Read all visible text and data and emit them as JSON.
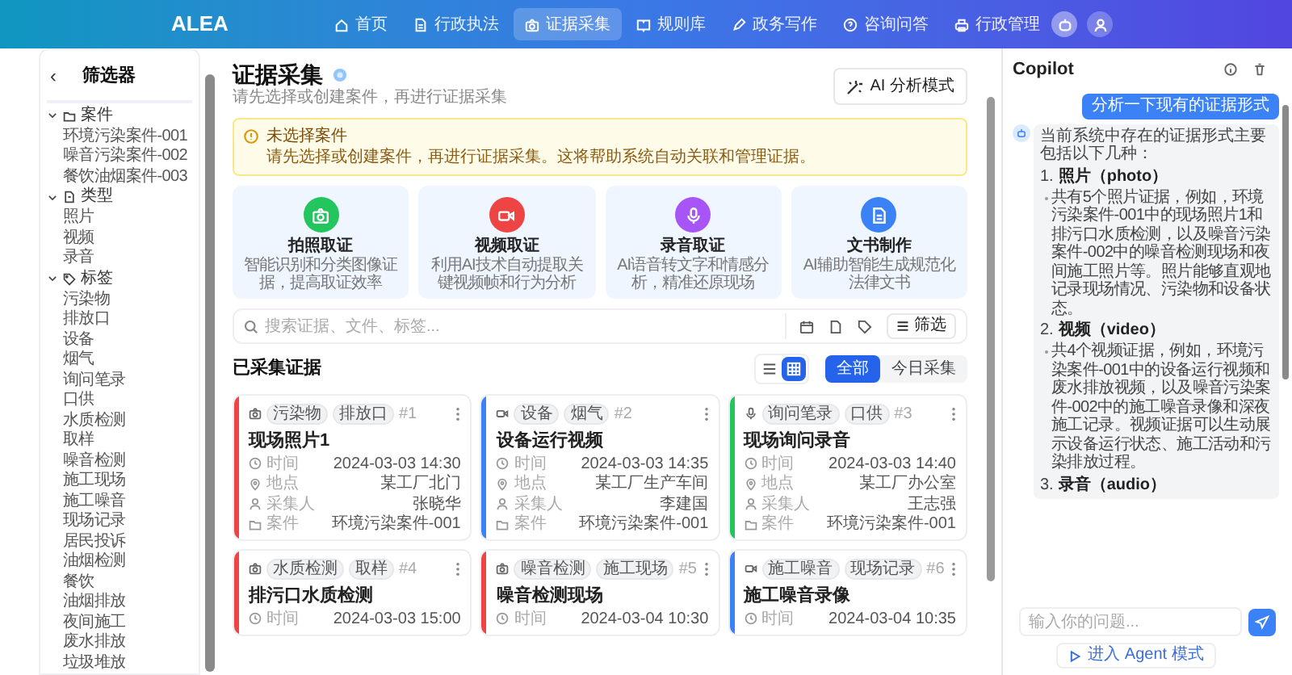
{
  "nav": {
    "logo": "ALEA",
    "items": [
      {
        "label": "首页",
        "selected": false
      },
      {
        "label": "行政执法",
        "selected": false
      },
      {
        "label": "证据采集",
        "selected": true
      },
      {
        "label": "规则库",
        "selected": false
      },
      {
        "label": "政务写作",
        "selected": false
      },
      {
        "label": "咨询问答",
        "selected": false
      },
      {
        "label": "行政管理",
        "selected": false
      }
    ]
  },
  "sidebar": {
    "back": "‹",
    "title": "筛选器",
    "groups": [
      {
        "label": "案件",
        "expanded": true,
        "children": [
          "环境污染案件-001",
          "噪音污染案件-002",
          "餐饮油烟案件-003"
        ]
      },
      {
        "label": "类型",
        "expanded": true,
        "children": [
          "照片",
          "视频",
          "录音"
        ]
      },
      {
        "label": "标签",
        "expanded": true,
        "children": [
          "污染物",
          "排放口",
          "设备",
          "烟气",
          "询问笔录",
          "口供",
          "水质检测",
          "取样",
          "噪音检测",
          "施工现场",
          "施工噪音",
          "现场记录",
          "居民投诉",
          "油烟检测",
          "餐饮",
          "油烟排放",
          "夜间施工",
          "废水排放",
          "垃圾堆放"
        ]
      }
    ]
  },
  "main": {
    "title": "证据采集",
    "subtitle": "请先选择或创建案件，再进行证据采集",
    "ai_button": "AI 分析模式",
    "alert": {
      "title": "未选择案件",
      "text": "请先选择或创建案件，再进行证据采集。这将帮助系统自动关联和管理证据。"
    },
    "features": [
      {
        "kind": "photo",
        "color": "#22c55e",
        "title": "拍照取证",
        "text": "智能识别和分类图像证据，提高取证效率"
      },
      {
        "kind": "video",
        "color": "#ef4444",
        "title": "视频取证",
        "text": "利用AI技术自动提取关键视频帧和行为分析"
      },
      {
        "kind": "audio",
        "color": "#a855f7",
        "title": "录音取证",
        "text": "AI语音转文字和情感分析，精准还原现场"
      },
      {
        "kind": "doc",
        "color": "#3b82f6",
        "title": "文书制作",
        "text": "AI辅助智能生成规范化法律文书"
      }
    ],
    "search": {
      "placeholder": "搜索证据、文件、标签...",
      "filter": "筛选"
    },
    "section_title": "已采集证据",
    "views": [
      {
        "kind": "list",
        "selected": false
      },
      {
        "kind": "grid",
        "selected": true
      }
    ],
    "scopes": [
      {
        "label": "全部",
        "selected": true
      },
      {
        "label": "今日采集",
        "selected": false
      }
    ],
    "evidence": [
      {
        "kind": "photo",
        "color": "#ef4444",
        "tags": [
          "污染物",
          "排放口"
        ],
        "number": "#1",
        "title": "现场照片1",
        "fields": [
          {
            "kind": "time",
            "label": "时间",
            "value": "2024-03-03 14:30"
          },
          {
            "kind": "place",
            "label": "地点",
            "value": "某工厂北门"
          },
          {
            "kind": "collector",
            "label": "采集人",
            "value": "张晓华"
          },
          {
            "kind": "case",
            "label": "案件",
            "value": "环境污染案件-001"
          }
        ]
      },
      {
        "kind": "video",
        "color": "#3b82f6",
        "tags": [
          "设备",
          "烟气"
        ],
        "number": "#2",
        "title": "设备运行视频",
        "fields": [
          {
            "kind": "time",
            "label": "时间",
            "value": "2024-03-03 14:35"
          },
          {
            "kind": "place",
            "label": "地点",
            "value": "某工厂生产车间"
          },
          {
            "kind": "collector",
            "label": "采集人",
            "value": "李建国"
          },
          {
            "kind": "case",
            "label": "案件",
            "value": "环境污染案件-001"
          }
        ]
      },
      {
        "kind": "audio",
        "color": "#22c55e",
        "tags": [
          "询问笔录",
          "口供"
        ],
        "number": "#3",
        "title": "现场询问录音",
        "fields": [
          {
            "kind": "time",
            "label": "时间",
            "value": "2024-03-03 14:40"
          },
          {
            "kind": "place",
            "label": "地点",
            "value": "某工厂办公室"
          },
          {
            "kind": "collector",
            "label": "采集人",
            "value": "王志强"
          },
          {
            "kind": "case",
            "label": "案件",
            "value": "环境污染案件-001"
          }
        ]
      },
      {
        "kind": "photo",
        "color": "#ef4444",
        "tags": [
          "水质检测",
          "取样"
        ],
        "number": "#4",
        "title": "排污口水质检测",
        "fields": [
          {
            "kind": "time",
            "label": "时间",
            "value": "2024-03-03 15:00"
          }
        ]
      },
      {
        "kind": "photo",
        "color": "#ef4444",
        "tags": [
          "噪音检测",
          "施工现场"
        ],
        "number": "#5",
        "title": "噪音检测现场",
        "fields": [
          {
            "kind": "time",
            "label": "时间",
            "value": "2024-03-04 10:30"
          }
        ]
      },
      {
        "kind": "video",
        "color": "#3b82f6",
        "tags": [
          "施工噪音",
          "现场记录"
        ],
        "number": "#6",
        "title": "施工噪音录像",
        "fields": [
          {
            "kind": "time",
            "label": "时间",
            "value": "2024-03-04 10:35"
          }
        ]
      }
    ]
  },
  "copilot": {
    "title": "Copilot",
    "messages": [
      {
        "kind": "user",
        "text": "分析一下现有的证据形式"
      },
      {
        "kind": "assistant",
        "intro": "当前系统中存在的证据形式主要包括以下几种：",
        "items": [
          {
            "number": "1.",
            "title": "照片（photo）",
            "detail": "共有5个照片证据，例如，环境污染案件-001中的现场照片1和排污口水质检测，以及噪音污染案件-002中的噪音检测现场和夜间施工照片等。照片能够直观地记录现场情况、污染物和设备状态。"
          },
          {
            "number": "2.",
            "title": "视频（video）",
            "detail": "共4个视频证据，例如，环境污染案件-001中的设备运行视频和废水排放视频，以及噪音污染案件-002中的施工噪音录像和深夜施工记录。视频证据可以生动展示设备运行状态、施工活动和污染排放过程。"
          },
          {
            "number": "3.",
            "title": "录音（audio）"
          }
        ]
      }
    ],
    "input_placeholder": "输入你的问题...",
    "agent_button": "进入 Agent 模式"
  }
}
